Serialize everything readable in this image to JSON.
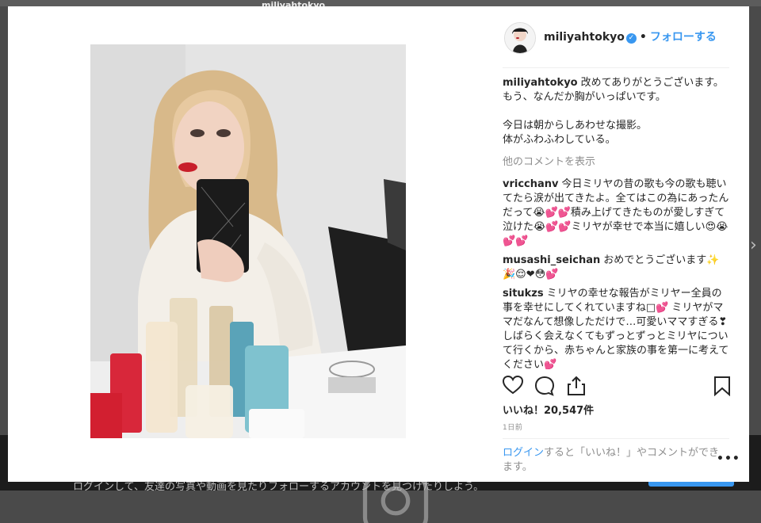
{
  "backdrop": {
    "bottom_text": "ログインして、友達の写真や動画を見たりフォローするアカウントを見つけたりしよう。",
    "top_peek": "miliyahtokyo"
  },
  "post": {
    "username": "miliyahtokyo",
    "follow_label": "フォローする",
    "dot": "•",
    "caption": {
      "lines": [
        "改めてありがとうございます。",
        "もう、なんだか胸がいっぱいです。",
        "",
        "今日は朝からしあわせな撮影。",
        "体がふわふわしている。"
      ]
    },
    "more_comments_label": "他のコメントを表示",
    "comments": [
      {
        "user": "vricchanv",
        "text": "今日ミリヤの昔の歌も今の歌も聴いてたら涙が出てきたよ。全てはこの為にあったんだって😭💕💕積み上げてきたものが愛しすぎて泣けた😭💕💕ミリヤが幸せで本当に嬉しい😍😭💕💕"
      },
      {
        "user": "musashi_seichan",
        "text": "おめでとうございます✨🎉😌❤😳💕"
      },
      {
        "user": "situkzs",
        "text": "ミリヤの幸せな報告がミリヤー全員の事を幸せにしてくれていますね□💕 ミリヤがママだなんて想像しただけで…可愛いママすぎる❣ しばらく会えなくてもずっとずっとミリヤについて行くから、赤ちゃんと家族の事を第一に考えてください💕"
      }
    ],
    "likes": "いいね！20,547件",
    "time": "1日前",
    "login": {
      "link": "ログイン",
      "rest": "すると「いいね！」やコメントができます。"
    },
    "more_options": "•••"
  },
  "icons": [
    "heart-icon",
    "comment-icon",
    "share-icon",
    "bookmark-icon",
    "verified-icon",
    "camera-icon",
    "chevron-right-icon"
  ],
  "colors": {
    "accent": "#3897f0",
    "muted": "#8e8e8e",
    "text": "#262626"
  }
}
